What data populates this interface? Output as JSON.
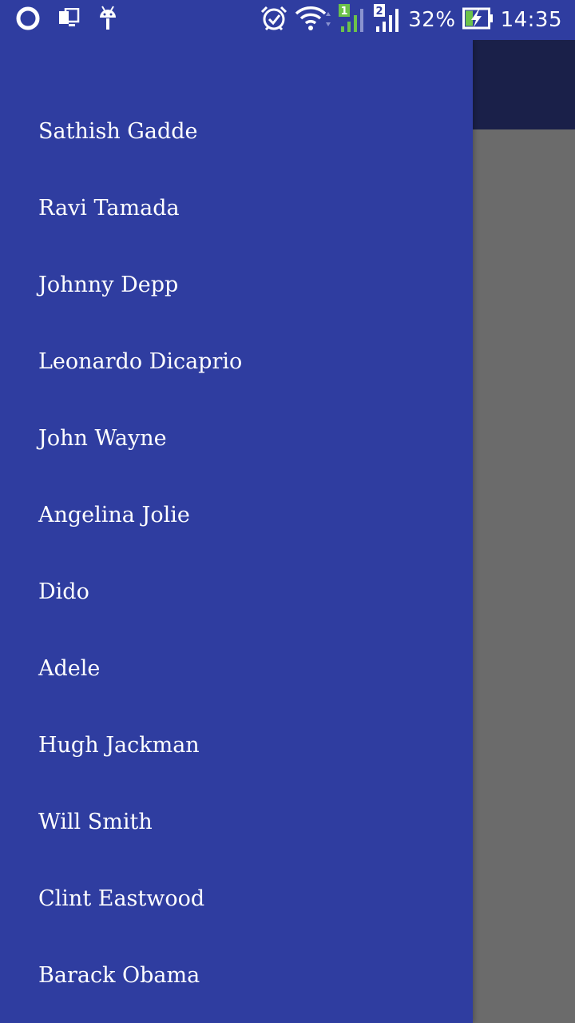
{
  "status_bar": {
    "battery_percent": "32%",
    "time": "14:35",
    "sim1_label": "1",
    "sim2_label": "2",
    "icons": [
      "opera-icon",
      "screen-mirror-icon",
      "android-icon",
      "alarm-icon",
      "wifi-icon",
      "signal-sim1-icon",
      "signal-sim2-icon",
      "battery-charging-icon"
    ],
    "colors": {
      "background": "#2f3da0",
      "sim1_accent": "#6cc24a"
    }
  },
  "drawer": {
    "items": [
      {
        "label": "Sathish Gadde"
      },
      {
        "label": "Ravi Tamada"
      },
      {
        "label": "Johnny Depp"
      },
      {
        "label": "Leonardo Dicaprio"
      },
      {
        "label": "John Wayne"
      },
      {
        "label": "Angelina Jolie"
      },
      {
        "label": "Dido"
      },
      {
        "label": "Adele"
      },
      {
        "label": "Hugh Jackman"
      },
      {
        "label": "Will Smith"
      },
      {
        "label": "Clint Eastwood"
      },
      {
        "label": "Barack Obama"
      }
    ],
    "colors": {
      "background": "#2f3da0",
      "text": "#ffffff"
    }
  },
  "app": {
    "colors": {
      "toolbar": "#1a2049",
      "scrim": "#6b6b6b"
    }
  }
}
